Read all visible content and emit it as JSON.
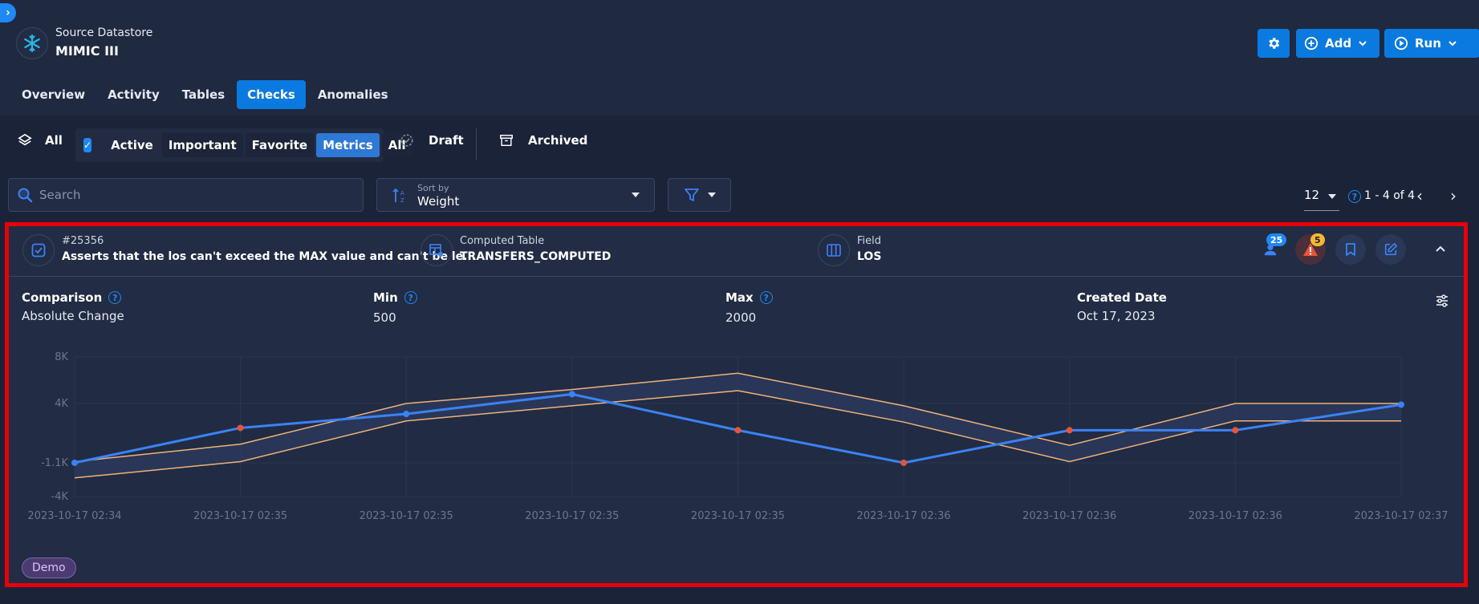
{
  "header": {
    "datastore_label": "Source Datastore",
    "datastore_name": "MIMIC III",
    "add_label": "Add",
    "run_label": "Run"
  },
  "tabs": [
    {
      "label": "Overview"
    },
    {
      "label": "Activity"
    },
    {
      "label": "Tables"
    },
    {
      "label": "Checks",
      "active": true
    },
    {
      "label": "Anomalies"
    }
  ],
  "filters": {
    "all_label": "All",
    "group": [
      "Active",
      "Important",
      "Favorite",
      "Metrics",
      "All"
    ],
    "selected": "Metrics",
    "draft_label": "Draft",
    "archived_label": "Archived"
  },
  "search": {
    "placeholder": "Search"
  },
  "sort": {
    "caption": "Sort by",
    "value": "Weight"
  },
  "pager": {
    "per_page": "12",
    "range": "1 - 4 of 4"
  },
  "check": {
    "id": "#25356",
    "description": "Asserts that the los can't exceed the MAX value and can't be le...",
    "table_label": "Computed Table",
    "table_value": "TRANSFERS_COMPUTED",
    "field_label": "Field",
    "field_value": "LOS",
    "count_badge": "25",
    "anomaly_badge": "5",
    "comparison_label": "Comparison",
    "comparison_value": "Absolute Change",
    "min_label": "Min",
    "min_value": "500",
    "max_label": "Max",
    "max_value": "2000",
    "created_label": "Created Date",
    "created_value": "Oct 17, 2023",
    "tag": "Demo"
  },
  "colors": {
    "accent": "#0b7ae0",
    "metric_line": "#3b82f6",
    "band_line": "#f0b27a",
    "anomaly_point": "#e8543a",
    "highlight_border": "#e8000b"
  },
  "chart_data": {
    "type": "line",
    "x": [
      "2023-10-17 02:34",
      "2023-10-17 02:35",
      "2023-10-17 02:35",
      "2023-10-17 02:35",
      "2023-10-17 02:35",
      "2023-10-17 02:36",
      "2023-10-17 02:36",
      "2023-10-17 02:36",
      "2023-10-17 02:37"
    ],
    "y_ticks": [
      8000,
      4000,
      -1100,
      -4000
    ],
    "y_tick_labels": [
      "8K",
      "4K",
      "-1.1K",
      "-4K"
    ],
    "ylim": [
      -4000,
      8000
    ],
    "series": [
      {
        "role": "metric",
        "values": [
          -1100,
          1900,
          3100,
          4800,
          1700,
          -1100,
          1700,
          1700,
          3900
        ],
        "anomaly": [
          false,
          true,
          false,
          false,
          true,
          true,
          true,
          true,
          false
        ]
      },
      {
        "role": "upper",
        "values": [
          -1000,
          500,
          4000,
          5200,
          6600,
          3800,
          400,
          4000,
          4000
        ]
      },
      {
        "role": "lower",
        "values": [
          -2400,
          -1000,
          2500,
          3800,
          5100,
          2400,
          -1000,
          2500,
          2500
        ]
      }
    ]
  }
}
